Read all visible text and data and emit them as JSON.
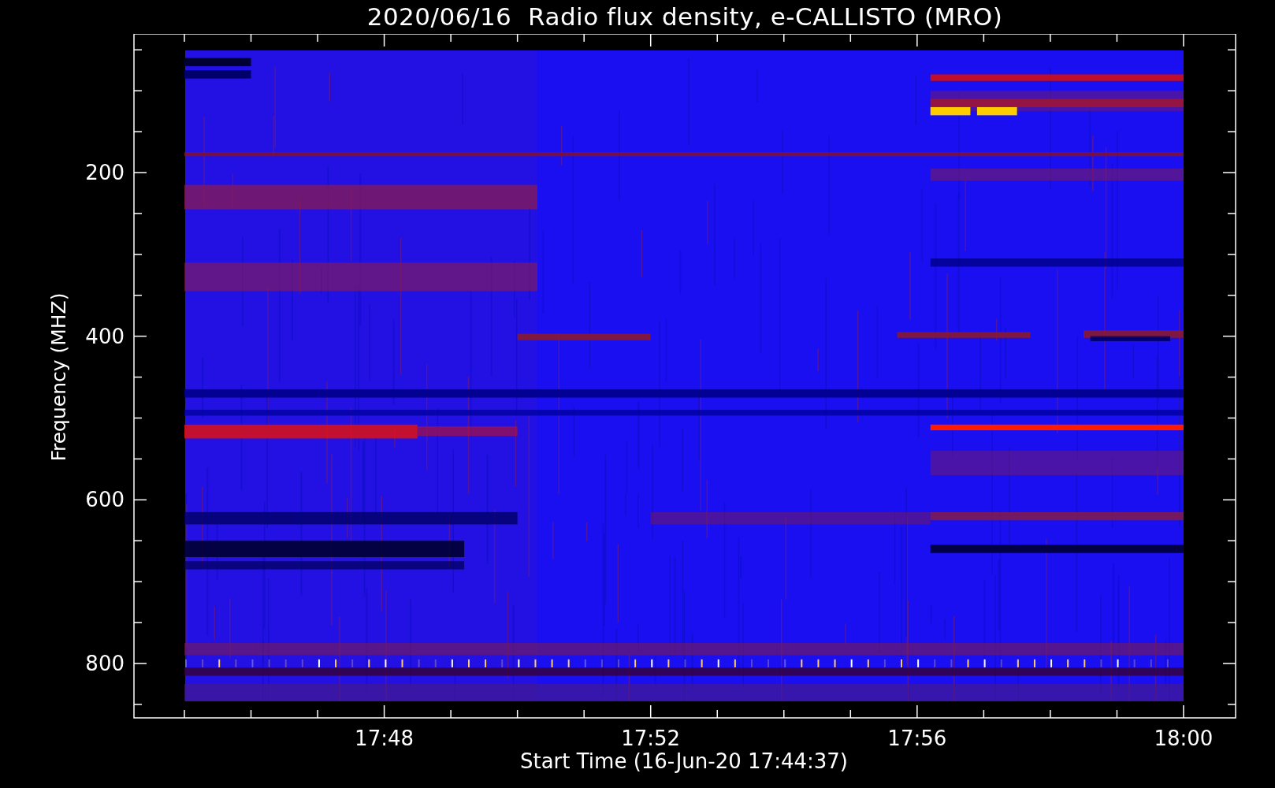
{
  "title": "2020/06/16  Radio flux density, e-CALLISTO (MRO)",
  "ylabel": "Frequency (MHZ)",
  "yticks": [
    "200",
    "400",
    "600",
    "800"
  ],
  "xticks": [
    "17:48",
    "17:52",
    "17:56",
    "18:00"
  ],
  "xlabel": "Start Time (16-Jun-20 17:44:37)"
}
